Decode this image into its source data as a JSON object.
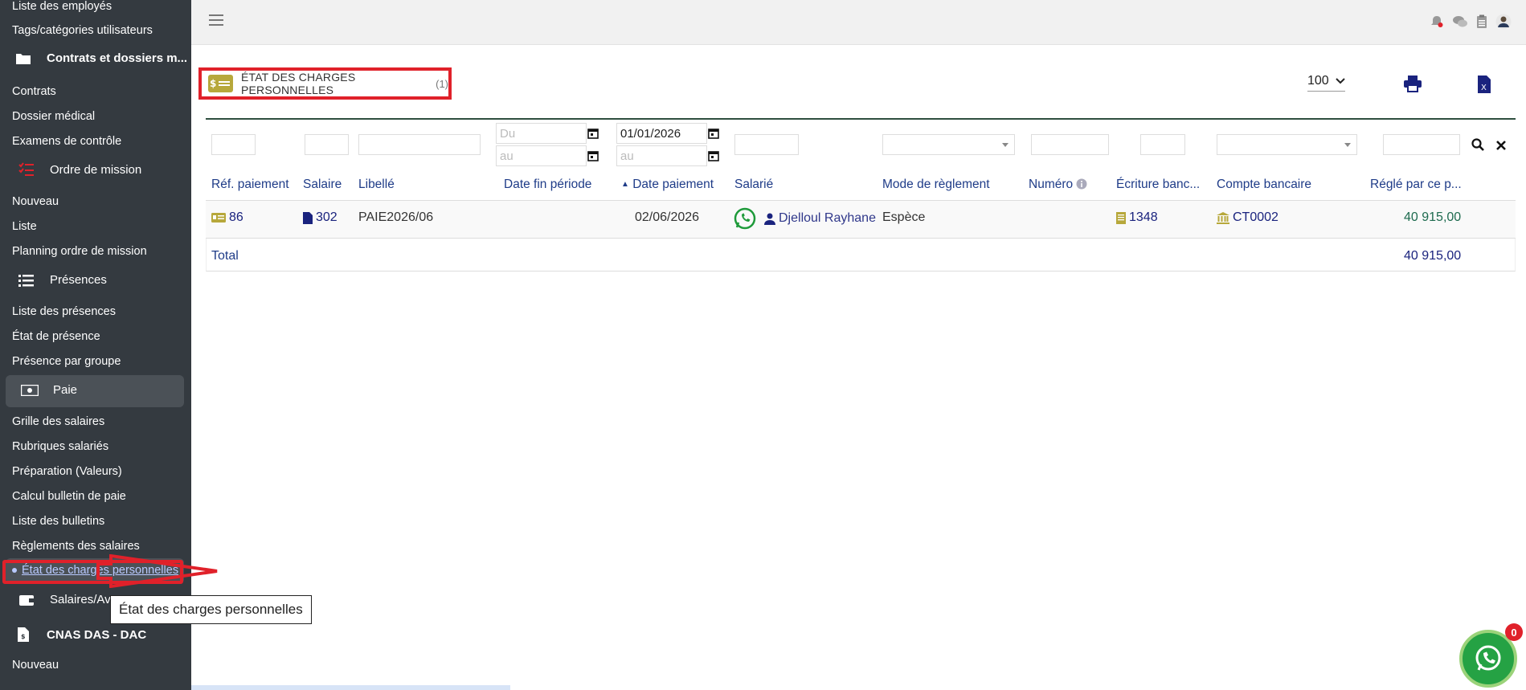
{
  "sidebar": {
    "items_top": [
      {
        "label": "Liste des employés"
      },
      {
        "label": "Tags/catégories utilisateurs"
      }
    ],
    "section_contrats": "Contrats et dossiers m...",
    "contrats_items": [
      "Contrats",
      "Dossier médical",
      "Examens de contrôle"
    ],
    "section_mission": "Ordre de mission",
    "mission_items": [
      "Nouveau",
      "Liste",
      "Planning ordre de mission"
    ],
    "section_presences": "Présences",
    "presences_items": [
      "Liste des présences",
      "État de présence",
      "Présence par groupe"
    ],
    "section_paie": "Paie",
    "paie_items": [
      "Grille des salaires",
      "Rubriques salariés",
      "Préparation (Valeurs)",
      "Calcul bulletin de paie",
      "Liste des bulletins",
      "Règlements des salaires"
    ],
    "current_item": "État des charges personnelles",
    "section_salaires": "Salaires/Avances",
    "section_cnas": "CNAS DAS - DAC",
    "cnas_items": [
      "Nouveau"
    ]
  },
  "tooltip": "État des charges personnelles",
  "page": {
    "title": "ÉTAT DES CHARGES PERSONNELLES",
    "count": "(1)",
    "badge": "$",
    "page_size": "100"
  },
  "filters": {
    "date_fin_from_placeholder": "Du",
    "date_fin_to_placeholder": "au",
    "date_paiement_from": "01/01/2026",
    "date_paiement_to_placeholder": "au"
  },
  "columns": [
    "Réf. paiement",
    "Salaire",
    "Libellé",
    "Date fin période",
    "Date paiement",
    "Salarié",
    "Mode de règlement",
    "Numéro",
    "Écriture banc...",
    "Compte bancaire",
    "Réglé par ce p..."
  ],
  "sort_indicator": "▲",
  "row": {
    "ref": "86",
    "salaire": "302",
    "libelle": "PAIE2026/06",
    "date_fin": "",
    "date_paiement": "02/06/2026",
    "salarie": "Djelloul Rayhane",
    "mode": "Espèce",
    "numero": "",
    "ecriture": "1348",
    "compte": "CT0002",
    "regle": "40 915,00"
  },
  "total": {
    "label": "Total",
    "value": "40 915,00"
  },
  "whatsapp_badge": "0",
  "colors": {
    "sidebar_bg": "#343a40",
    "accent_gold": "#b7a83b",
    "link_navy": "#1a237e",
    "highlight_red": "#e0212a",
    "whatsapp_green": "#25a244"
  }
}
